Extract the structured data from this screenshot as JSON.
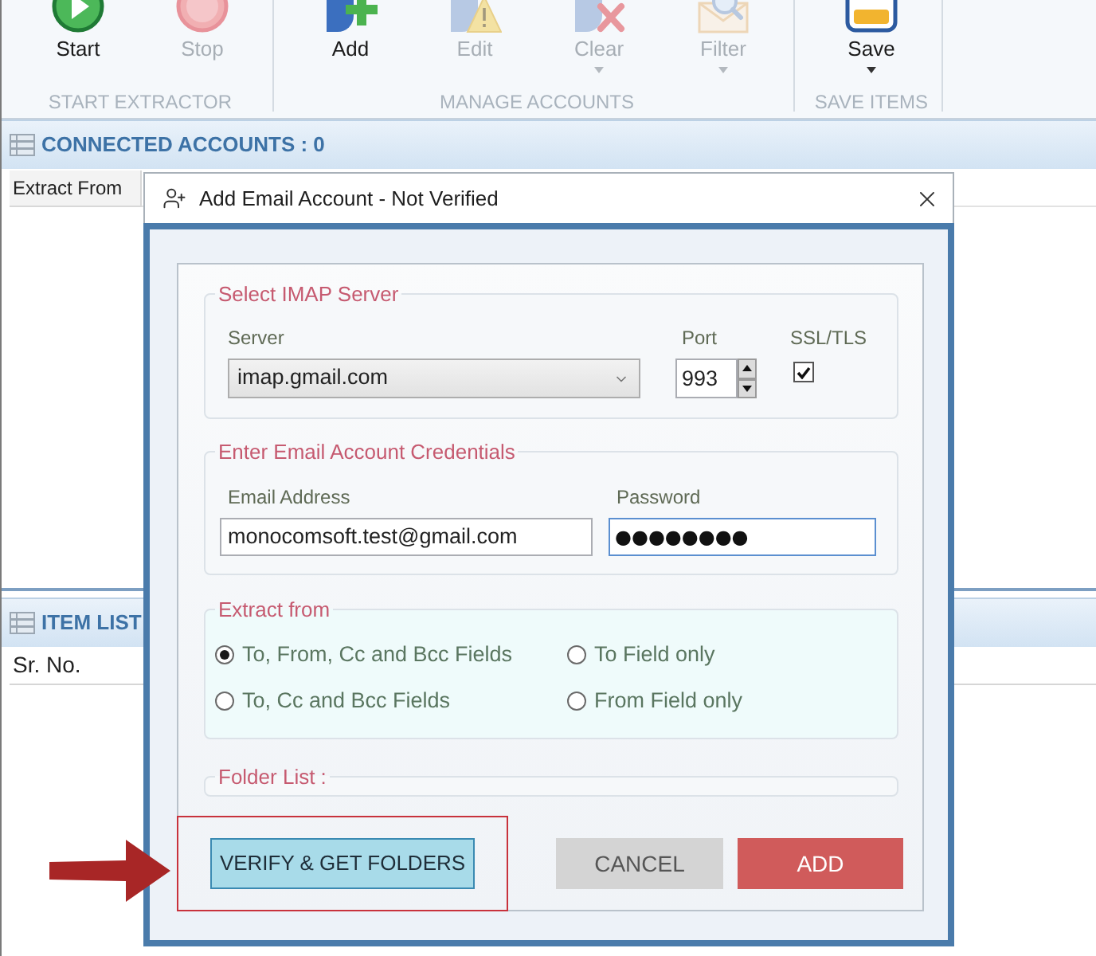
{
  "ribbon": {
    "groups": [
      {
        "label": "START EXTRACTOR",
        "buttons": [
          {
            "kind": "start",
            "label": "Start",
            "disabled": false,
            "dropdown": false
          },
          {
            "kind": "stop",
            "label": "Stop",
            "disabled": true,
            "dropdown": false
          }
        ]
      },
      {
        "label": "MANAGE ACCOUNTS",
        "buttons": [
          {
            "kind": "add",
            "label": "Add",
            "disabled": false,
            "dropdown": false
          },
          {
            "kind": "edit",
            "label": "Edit",
            "disabled": true,
            "dropdown": false
          },
          {
            "kind": "clear",
            "label": "Clear",
            "disabled": true,
            "dropdown": true
          },
          {
            "kind": "filter",
            "label": "Filter",
            "disabled": true,
            "dropdown": true
          }
        ]
      },
      {
        "label": "SAVE ITEMS",
        "buttons": [
          {
            "kind": "save",
            "label": "Save",
            "disabled": false,
            "dropdown": true
          }
        ]
      }
    ]
  },
  "connected_accounts": {
    "title": "CONNECTED ACCOUNTS : 0",
    "columns": [
      "Extract From"
    ]
  },
  "item_list": {
    "title": "ITEM LIST",
    "columns": [
      "Sr. No."
    ]
  },
  "dialog": {
    "title": "Add Email Account - Not Verified",
    "imap": {
      "legend": "Select IMAP Server",
      "server_label": "Server",
      "server": "imap.gmail.com",
      "port_label": "Port",
      "port": "993",
      "ssl_label": "SSL/TLS",
      "ssl_checked": true
    },
    "credentials": {
      "legend": "Enter Email Account Credentials",
      "email_label": "Email Address",
      "email": "monocomsoft.test@gmail.com",
      "password_label": "Password",
      "password": "●●●●●●●●",
      "password_focused": true
    },
    "extract_from": {
      "legend": "Extract from",
      "options": [
        {
          "label": "To, From, Cc and Bcc Fields",
          "selected": true
        },
        {
          "label": "To Field only",
          "selected": false
        },
        {
          "label": "To, Cc and Bcc Fields",
          "selected": false
        },
        {
          "label": "From Field only",
          "selected": false
        }
      ]
    },
    "folder_list": {
      "legend": "Folder List :"
    },
    "buttons": [
      {
        "kind": "verify",
        "label": "VERIFY & GET FOLDERS",
        "highlighted": true
      },
      {
        "kind": "cancel",
        "label": "CANCEL",
        "highlighted": false
      },
      {
        "kind": "add",
        "label": "ADD",
        "highlighted": false
      }
    ]
  }
}
